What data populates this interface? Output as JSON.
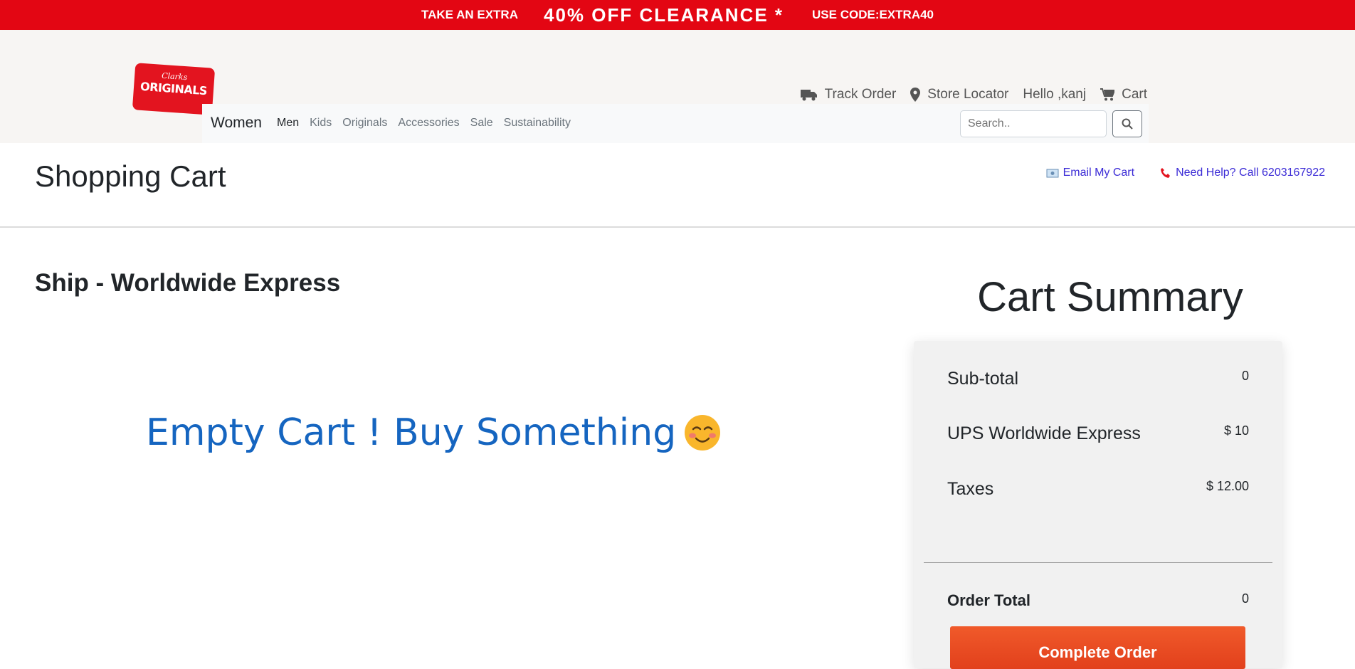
{
  "promo": {
    "part1": "TAKE AN EXTRA",
    "part2": "40% OFF CLEARANCE *",
    "part3": "USE CODE:EXTRA40",
    "bg_color": "#e30613"
  },
  "logo": {
    "line1": "Clarks",
    "line2": "ORIGINALS"
  },
  "topnav": {
    "track_order": "Track Order",
    "store_locator": "Store Locator",
    "greeting": "Hello ,kanj",
    "cart": "Cart"
  },
  "catnav": {
    "brand": "Women",
    "links": [
      "Men",
      "Kids",
      "Originals",
      "Accessories",
      "Sale",
      "Sustainability"
    ],
    "search_placeholder": "Search.."
  },
  "page": {
    "title": "Shopping Cart",
    "email_cart": "Email My Cart",
    "help": "Need Help? Call 6203167922",
    "ship_title": "Ship - Worldwide Express",
    "empty_message": "Empty Cart ! Buy Something"
  },
  "summary": {
    "title": "Cart Summary",
    "subtotal_label": "Sub-total",
    "subtotal_value": "0",
    "shipping_label": "UPS Worldwide Express",
    "shipping_value": "$ 10",
    "taxes_label": "Taxes",
    "taxes_value": "$ 12.00",
    "total_label": "Order Total",
    "total_value": "0",
    "button_label": "Complete Order",
    "button_color": "#e8471f"
  }
}
